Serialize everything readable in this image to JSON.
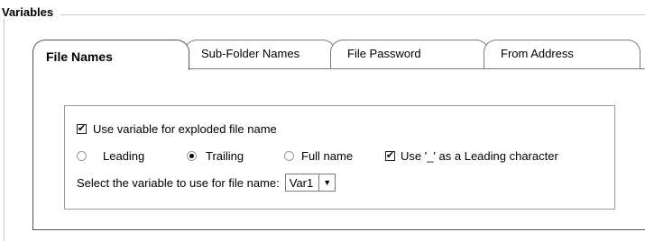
{
  "group": {
    "title": "Variables"
  },
  "tabs": [
    {
      "label": "File Names",
      "active": true
    },
    {
      "label": "Sub-Folder Names",
      "active": false
    },
    {
      "label": "File Password",
      "active": false
    },
    {
      "label": "From Address",
      "active": false
    }
  ],
  "options": {
    "exploded_checkbox": {
      "label": "Use variable for exploded file name",
      "checked": true
    },
    "radio_leading": {
      "label": "Leading",
      "selected": false
    },
    "radio_trailing": {
      "label": "Trailing",
      "selected": true
    },
    "radio_fullname": {
      "label": "Full name",
      "selected": false
    },
    "underscore_checkbox": {
      "label": "Use '_' as a Leading character",
      "checked": true
    },
    "variable_select": {
      "label": "Select the variable to use for file name:",
      "value": "Var1"
    }
  },
  "icons": {
    "checkmark": "check-icon",
    "dropdown": "triangle-down-icon"
  }
}
